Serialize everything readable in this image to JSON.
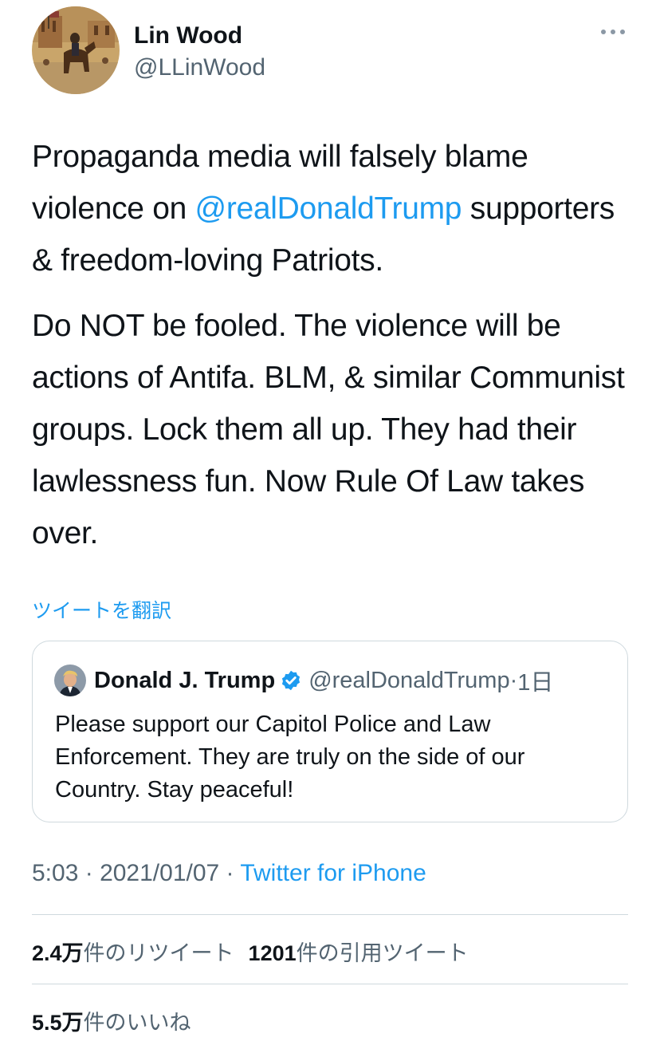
{
  "author": {
    "name": "Lin Wood",
    "handle": "@LLinWood"
  },
  "tweet": {
    "p1_before": "Propaganda media will falsely blame violence on ",
    "mention": "@realDonaldTrump",
    "p1_after": " supporters & freedom-loving Patriots.",
    "p2": "Do NOT be fooled. The violence will be actions of Antifa. BLM, & similar Communist groups. Lock them  all up. They had their lawlessness fun. Now Rule Of Law takes over."
  },
  "translate_label": "ツイートを翻訳",
  "quoted": {
    "name": "Donald J. Trump",
    "handle": "@realDonaldTrump",
    "separator": "·",
    "time": "1日",
    "text": "Please support our Capitol Police and Law Enforcement. They are truly on the side of our Country. Stay peaceful!"
  },
  "meta": {
    "time": "5:03",
    "sep1": " · ",
    "date": "2021/01/07",
    "sep2": " · ",
    "source": "Twitter for iPhone"
  },
  "stats": {
    "retweets_count": "2.4万",
    "retweets_label": "件のリツイート",
    "quotes_count": "1201",
    "quotes_label": "件の引用ツイート",
    "likes_count": "5.5万",
    "likes_label": "件のいいね"
  },
  "icons": {
    "more": "more-horizontal-icon",
    "verified": "verified-badge-icon"
  },
  "colors": {
    "link": "#1d9bf0",
    "secondary_text": "#536471",
    "primary_text": "#0f1419",
    "border": "#cfd9de"
  }
}
